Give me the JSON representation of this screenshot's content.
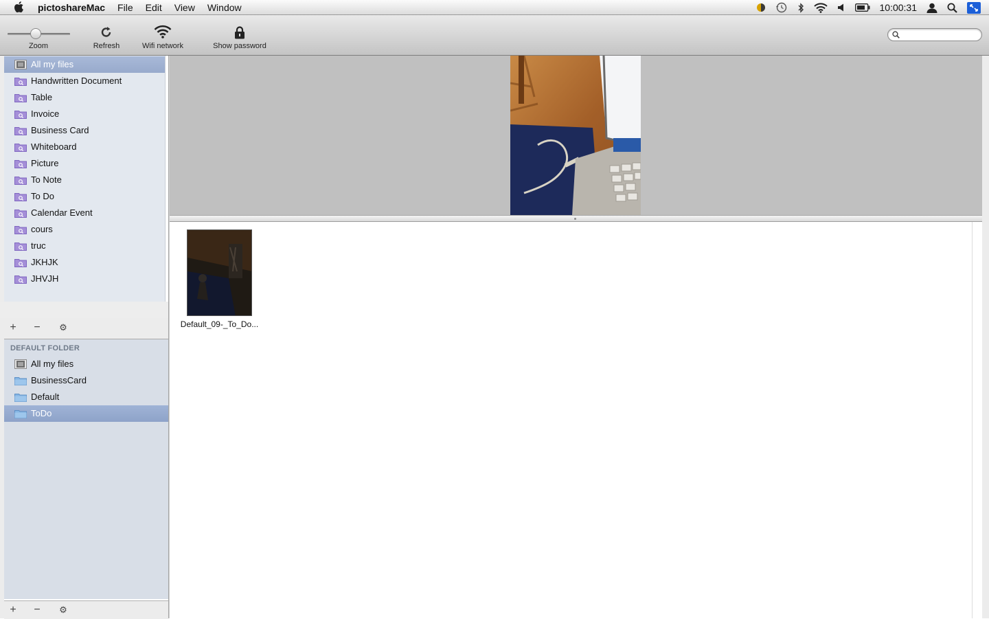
{
  "menubar": {
    "app_name": "pictoshareMac",
    "menus": [
      "File",
      "Edit",
      "View",
      "Window"
    ],
    "clock": "10:00:31",
    "status_icons": [
      "notification-icon",
      "time-machine-icon",
      "bluetooth-icon",
      "wifi-icon",
      "volume-icon",
      "battery-icon",
      "user-icon",
      "spotlight-icon",
      "screen-sharing-icon"
    ]
  },
  "toolbar": {
    "zoom_label": "Zoom",
    "zoom_level": 0.45,
    "refresh_label": "Refresh",
    "wifi_label": "Wifi network",
    "password_label": "Show password",
    "search_placeholder": "",
    "search_value": ""
  },
  "categories": {
    "items": [
      {
        "label": "All my files",
        "icon": "all-files-icon",
        "selected": true
      },
      {
        "label": "Handwritten Document",
        "icon": "smart-folder-icon"
      },
      {
        "label": "Table",
        "icon": "smart-folder-icon"
      },
      {
        "label": "Invoice",
        "icon": "smart-folder-icon"
      },
      {
        "label": "Business Card",
        "icon": "smart-folder-icon"
      },
      {
        "label": "Whiteboard",
        "icon": "smart-folder-icon"
      },
      {
        "label": "Picture",
        "icon": "smart-folder-icon"
      },
      {
        "label": "To Note",
        "icon": "smart-folder-icon"
      },
      {
        "label": "To Do",
        "icon": "smart-folder-icon"
      },
      {
        "label": "Calendar Event",
        "icon": "smart-folder-icon"
      },
      {
        "label": "cours",
        "icon": "smart-folder-icon"
      },
      {
        "label": "truc",
        "icon": "smart-folder-icon"
      },
      {
        "label": "JKHJK",
        "icon": "smart-folder-icon"
      },
      {
        "label": "JHVJH",
        "icon": "smart-folder-icon"
      }
    ]
  },
  "folders": {
    "header": "DEFAULT FOLDER",
    "items": [
      {
        "label": "All my files",
        "icon": "all-files-icon"
      },
      {
        "label": "BusinessCard",
        "icon": "folder-icon"
      },
      {
        "label": "Default",
        "icon": "folder-icon"
      },
      {
        "label": "ToDo",
        "icon": "folder-icon",
        "selected": true
      }
    ]
  },
  "footer_buttons": {
    "add": "+",
    "remove": "−",
    "action": "⚙"
  },
  "files": [
    {
      "name": "Default_09-_To_Do..."
    }
  ],
  "colors": {
    "selection": "#9aadce",
    "sidebar_bg": "#e3e8ef",
    "preview_bg": "#c0c0c0"
  }
}
